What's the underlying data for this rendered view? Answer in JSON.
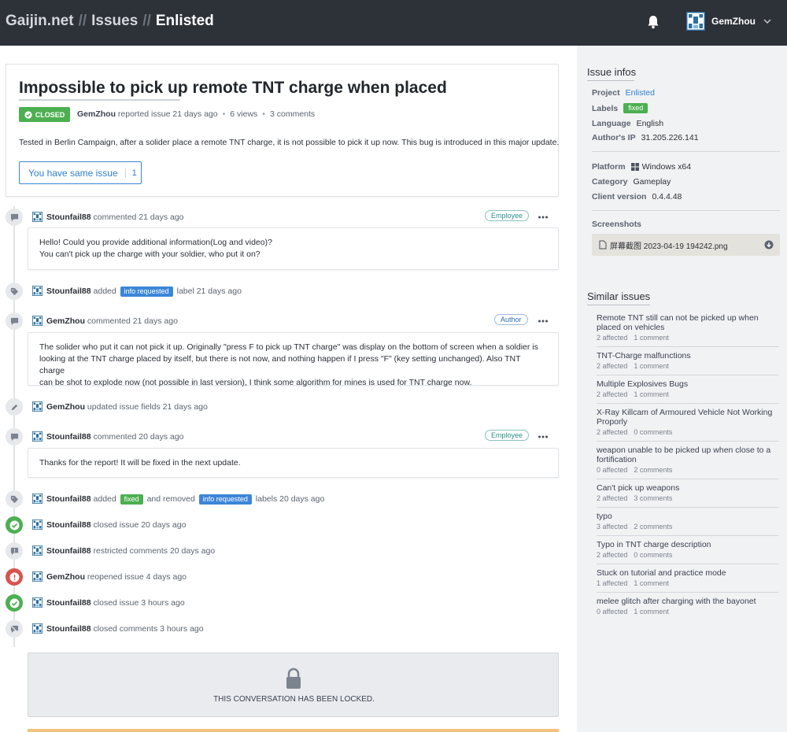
{
  "header": {
    "crumbs": [
      "Gaijin.net",
      "Issues",
      "Enlisted"
    ],
    "separator": "//",
    "user": "GemZhou"
  },
  "issue": {
    "title": "Impossible to pick up remote TNT charge when placed",
    "status": "CLOSED",
    "author": "GemZhou",
    "reported": "reported issue 21 days ago",
    "views": "6 views",
    "comments": "3 comments",
    "description": "Tested in Berlin Campaign, after a solider place a remote TNT charge, it is not possible to pick it up now. This bug is introduced in this major update.",
    "same_issue_label": "You have same issue",
    "same_issue_count": "1"
  },
  "timeline": [
    {
      "user": "Stounfail88",
      "action": "commented 21 days ago",
      "role": "Employee",
      "body": [
        "Hello! Could you provide additional information(Log and video)?",
        "You can't pick up the charge with your soldier, who put it on?"
      ]
    },
    {
      "user": "Stounfail88",
      "pre": "added",
      "label": "info requested",
      "post": "label 21 days ago"
    },
    {
      "user": "GemZhou",
      "action": "commented 21 days ago",
      "role": "Author",
      "body": [
        "The solider who put it can not pick it up. Originally \"press F to pick up TNT charge\" was display on the bottom of screen when a soldier is",
        "looking at the TNT charge placed by itself, but there is not now, and nothing happen if I press \"F\" (key setting unchanged). Also TNT charge",
        "can be shot to explode now (not possible in last version), I think some algorithm for mines is used for TNT charge now."
      ]
    },
    {
      "user": "GemZhou",
      "action": "updated issue fields 21 days ago"
    },
    {
      "user": "Stounfail88",
      "action": "commented 20 days ago",
      "role": "Employee",
      "body": [
        "Thanks for the report! It will be fixed in the next update."
      ]
    },
    {
      "user": "Stounfail88",
      "pre": "added",
      "label": "fixed",
      "mid": "and removed",
      "label2": "info requested",
      "post": "labels 20 days ago"
    },
    {
      "user": "Stounfail88",
      "action": "closed issue 20 days ago"
    },
    {
      "user": "Stounfail88",
      "action": "restricted comments 20 days ago"
    },
    {
      "user": "GemZhou",
      "action": "reopened issue 4 days ago"
    },
    {
      "user": "Stounfail88",
      "action": "closed issue 3 hours ago"
    },
    {
      "user": "Stounfail88",
      "action": "closed comments 3 hours ago"
    }
  ],
  "locked_text": "THIS CONVERSATION HAS BEEN LOCKED.",
  "sidebar": {
    "infos_title": "Issue infos",
    "fields": [
      {
        "k": "Project",
        "v": "Enlisted"
      },
      {
        "k": "Labels",
        "v": "fixed"
      },
      {
        "k": "Language",
        "v": "English"
      },
      {
        "k": "Author's IP",
        "v": "31.205.226.141"
      },
      {
        "k": "Platform",
        "v": "Windows x64"
      },
      {
        "k": "Category",
        "v": "Gameplay"
      },
      {
        "k": "Client version",
        "v": "0.4.4.48"
      }
    ],
    "screenshots_label": "Screenshots",
    "screenshot_file": "屏幕截图 2023-04-19 194242.png",
    "similar_title": "Similar issues",
    "similar": [
      {
        "title": "Remote TNT still can not be picked up when placed on vehicles",
        "affected": "2 affected",
        "comments": "1 comment"
      },
      {
        "title": "TNT-Charge malfunctions",
        "affected": "2 affected",
        "comments": "1 comment"
      },
      {
        "title": "Multiple Explosives Bugs",
        "affected": "2 affected",
        "comments": "1 comment"
      },
      {
        "title": "X-Ray Killcam of Armoured Vehicle Not Working Proporly",
        "affected": "2 affected",
        "comments": "0 comments"
      },
      {
        "title": "weapon unable to be picked up when close to a fortification",
        "affected": "0 affected",
        "comments": "2 comments"
      },
      {
        "title": "Can't pick up weapons",
        "affected": "2 affected",
        "comments": "3 comments"
      },
      {
        "title": "typo",
        "affected": "3 affected",
        "comments": "2 comments"
      },
      {
        "title": "Typo in TNT charge description",
        "affected": "2 affected",
        "comments": "0 comments"
      },
      {
        "title": "Stuck on tutorial and practice mode",
        "affected": "1 affected",
        "comments": "1 comment"
      },
      {
        "title": "melee glitch after charging with the bayonet",
        "affected": "0 affected",
        "comments": "1 comment"
      }
    ]
  },
  "colors": {
    "header_bg": "#2d3138",
    "closed": "#4caf50",
    "info_requested": "#3b86d8",
    "reopened": "#d9534f",
    "link": "#2f7fcf"
  }
}
